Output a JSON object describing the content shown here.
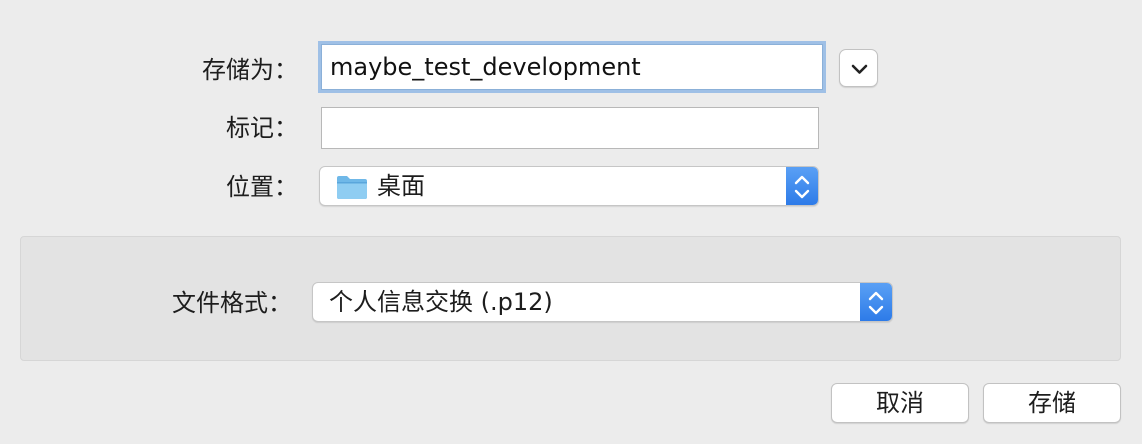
{
  "save_dialog": {
    "save_as_label": "存储为：",
    "save_as_value": "maybe_test_development",
    "tags_label": "标记：",
    "tags_value": "",
    "location_label": "位置：",
    "location_value": "桌面",
    "location_icon": "folder-icon",
    "format_label": "文件格式：",
    "format_value": "个人信息交换 (.p12)",
    "cancel_label": "取消",
    "save_label": "存储",
    "colors": {
      "background": "#ececec",
      "focus_ring": "#9fc0e6",
      "stepper_blue": "#2d7be8"
    }
  }
}
